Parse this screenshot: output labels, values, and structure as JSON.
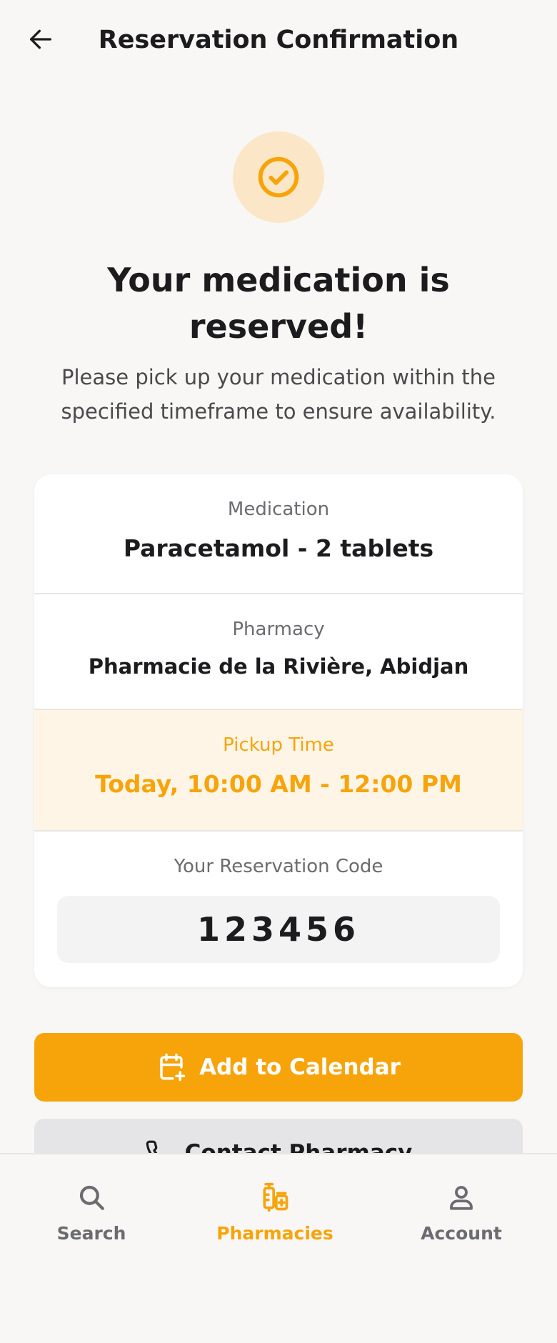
{
  "colors": {
    "accent": "#f7a40a",
    "accent_soft": "#fbe7c8",
    "highlight_bg": "#fef5e6",
    "text_primary": "#1c1c1e",
    "text_secondary": "#6b6b70"
  },
  "header": {
    "back_icon": "arrow-left-icon",
    "title": "Reservation Confirmation"
  },
  "status": {
    "icon": "check-circle-icon",
    "headline": "Your medication is reserved!",
    "message": "Please pick up your medication within the specified timeframe to ensure availability."
  },
  "details": {
    "medication": {
      "label": "Medication",
      "value": "Paracetamol - 2 tablets"
    },
    "pharmacy": {
      "label": "Pharmacy",
      "value": "Pharmacie de la Rivière, Abidjan"
    },
    "pickup": {
      "label": "Pickup Time",
      "value": "Today, 10:00 AM - 12:00 PM"
    },
    "code": {
      "label": "Your Reservation Code",
      "value": "123456"
    }
  },
  "actions": {
    "calendar": {
      "icon": "calendar-plus-icon",
      "label": "Add to Calendar"
    },
    "contact": {
      "icon": "phone-icon",
      "label": "Contact Pharmacy"
    }
  },
  "nav": {
    "items": [
      {
        "icon": "search-icon",
        "label": "Search",
        "active": false
      },
      {
        "icon": "pharmacy-icon",
        "label": "Pharmacies",
        "active": true
      },
      {
        "icon": "account-icon",
        "label": "Account",
        "active": false
      }
    ]
  }
}
